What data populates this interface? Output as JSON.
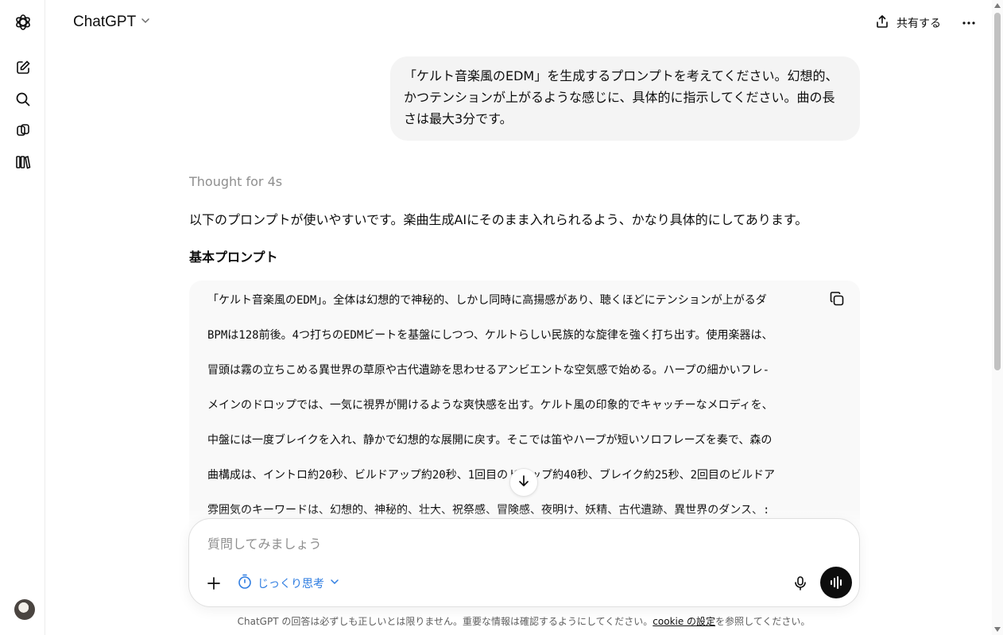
{
  "header": {
    "title": "ChatGPT",
    "share_label": "共有する"
  },
  "icons": {
    "logo": "openai-logo-icon",
    "new_chat": "new-chat-icon",
    "search": "search-icon",
    "gpts": "gpts-icon",
    "library": "library-icon",
    "share": "share-icon",
    "more": "more-icon",
    "copy": "copy-icon",
    "arrow_down": "arrow-down-icon",
    "plus": "plus-icon",
    "timer": "timer-icon",
    "chevron": "chevron-down-icon",
    "mic": "mic-icon",
    "voice": "voice-mode-icon"
  },
  "conversation": {
    "user_message": "「ケルト音楽風のEDM」を生成するプロンプトを考えてください。幻想的、かつテンションが上がるような感じに、具体的に指示してください。曲の長さは最大3分です。",
    "thought_label": "Thought for 4s",
    "intro": "以下のプロンプトが使いやすいです。楽曲生成AIにそのまま入れられるよう、かなり具体的にしてあります。",
    "section_heading": "基本プロンプト",
    "code_lines": [
      "「ケルト音楽風のEDM」。全体は幻想的で神秘的、しかし同時に高揚感があり、聴くほどにテンションが上がるダ",
      "BPMは128前後。4つ打ちのEDMビートを基盤にしつつ、ケルトらしい民族的な旋律を強く打ち出す。使用楽器は、",
      "冒頭は霧の立ちこめる異世界の草原や古代遺跡を思わせるアンビエントな空気感で始める。ハープの細かいフレ-",
      "メインのドロップでは、一気に視界が開けるような爽快感を出す。ケルト風の印象的でキャッチーなメロディを、",
      "中盤には一度ブレイクを入れ、静かで幻想的な展開に戻す。そこでは笛やハープが短いソロフレーズを奏で、森の",
      "曲構成は、イントロ約20秒、ビルドアップ約20秒、1回目のドロップ約40秒、ブレイク約25秒、2回目のビルドア",
      "雰囲気のキーワードは、幻想的、神秘的、壮大、祝祭感、冒険感、夜明け、妖精、古代遺跡、異世界のダンス、:"
    ]
  },
  "composer": {
    "placeholder": "質問してみましょう",
    "think_mode_label": "じっくり思考"
  },
  "footer": {
    "text_before": "ChatGPT の回答は必ずしも正しいとは限りません。重要な情報は確認するようにしてください。",
    "link_label": "cookie の設定",
    "text_after": "を参照してください。"
  },
  "colors": {
    "accent": "#2f7de1",
    "bubble_bg": "#f4f4f4",
    "code_bg": "#f9f9f9",
    "muted_text": "#8f8f8f"
  }
}
